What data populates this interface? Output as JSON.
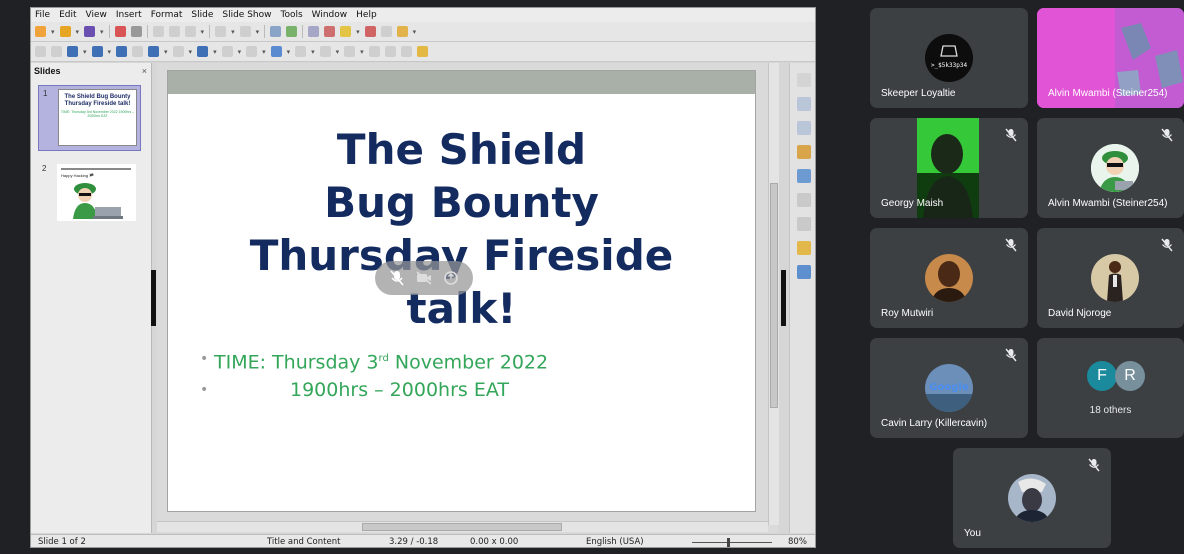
{
  "app": {
    "menu": [
      "File",
      "Edit",
      "View",
      "Insert",
      "Format",
      "Slide",
      "Slide Show",
      "Tools",
      "Window",
      "Help"
    ],
    "slides_panel": {
      "title": "Slides",
      "close": "×",
      "thumbs": [
        {
          "num": "1",
          "title": "The Shield Bug Bounty Thursday Fireside talk!",
          "sub": "TIME: Thursday 3rd November 2022 1900hrs – 2000hrs EAT"
        },
        {
          "num": "2",
          "text": "Happy Hacking 🏴"
        }
      ]
    },
    "slide": {
      "title_lines": [
        "The Shield",
        "Bug Bounty",
        "Thursday Fireside",
        "talk!"
      ],
      "bullet1_pre": "TIME: Thursday 3",
      "bullet1_sup": "rd",
      "bullet1_post": " November 2022",
      "bullet2": "1900hrs – 2000hrs EAT",
      "bullet_char": "•"
    },
    "statusbar": {
      "slide_of": "Slide 1 of 2",
      "layout": "Title and Content",
      "position": "3.29 / -0.18",
      "size": "0.00 x 0.00",
      "language": "English (USA)",
      "zoom": "80%"
    },
    "colors": {
      "title": "#142b60",
      "bullet": "#33a65a",
      "thumb_selected": "#b4b2df"
    }
  },
  "meet": {
    "participants": [
      {
        "name": "Skeeper Loyaltie",
        "avatar_text": ">_$5k33p34",
        "muted": false
      },
      {
        "name": "Alvin Mwambi (Steiner254)",
        "muted": false,
        "screen": true
      },
      {
        "name": "Georgy Maish",
        "muted": true
      },
      {
        "name": "Alvin Mwambi (Steiner254)",
        "muted": true
      },
      {
        "name": "Roy Mutwiri",
        "muted": true
      },
      {
        "name": "David Njoroge",
        "muted": true
      },
      {
        "name": "Cavin Larry (Killercavin)",
        "avatar_text": "Google",
        "muted": true
      },
      {
        "name": "You",
        "muted": true
      }
    ],
    "others": {
      "initials": [
        "F",
        "R"
      ],
      "label": "18 others",
      "colors": [
        "#1a8a9c",
        "#78909c"
      ]
    }
  }
}
